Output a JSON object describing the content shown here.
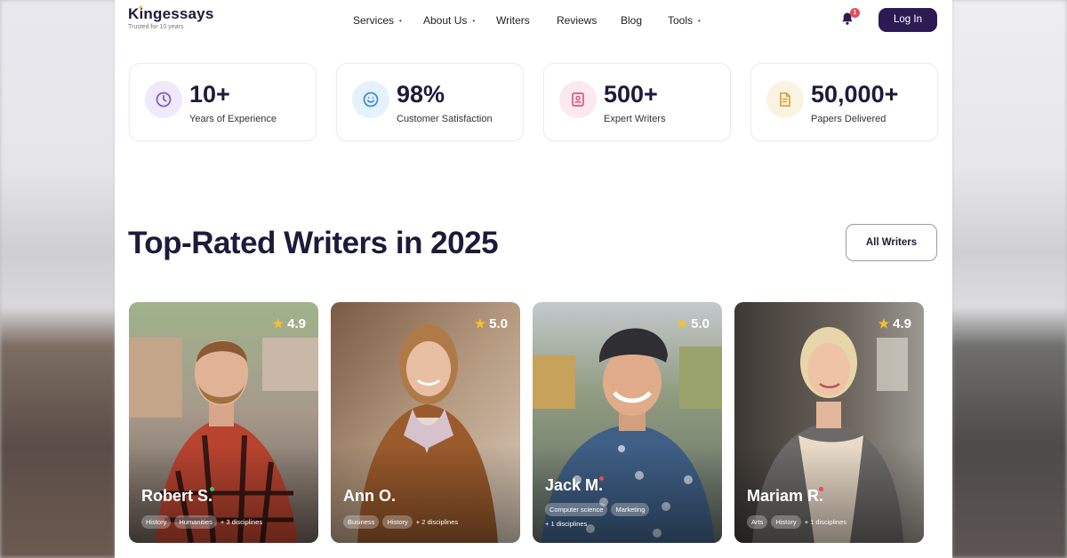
{
  "brand": {
    "name": "Kingessays",
    "tagline": "Trusted for 10 years"
  },
  "nav": [
    {
      "label": "Services",
      "dropdown": true
    },
    {
      "label": "About Us",
      "dropdown": true
    },
    {
      "label": "Writers",
      "dropdown": false
    },
    {
      "label": "Reviews",
      "dropdown": false
    },
    {
      "label": "Blog",
      "dropdown": false
    },
    {
      "label": "Tools",
      "dropdown": true
    }
  ],
  "notifications": {
    "count": "1"
  },
  "login_label": "Log In",
  "stats": [
    {
      "value": "10+",
      "label": "Years of Experience",
      "icon": "clock-icon",
      "color": "#7c5cc9",
      "bg": "#efe9fb"
    },
    {
      "value": "98%",
      "label": "Customer Satisfaction",
      "icon": "smile-icon",
      "color": "#3d8ed6",
      "bg": "#e5f1fb"
    },
    {
      "value": "500+",
      "label": "Expert Writers",
      "icon": "badge-icon",
      "color": "#d9577f",
      "bg": "#fbe9ef"
    },
    {
      "value": "50,000+",
      "label": "Papers Delivered",
      "icon": "document-icon",
      "color": "#d9a23a",
      "bg": "#fbf3e2"
    }
  ],
  "section": {
    "title": "Top-Rated Writers in 2025",
    "all_writers_label": "All Writers"
  },
  "writers": [
    {
      "name": "Robert S.",
      "rating": "4.9",
      "tags": [
        "History",
        "Humanities"
      ],
      "more": "+ 3 disciplines",
      "status_color": "#44c26b"
    },
    {
      "name": "Ann O.",
      "rating": "5.0",
      "tags": [
        "Business",
        "History"
      ],
      "more": "+ 2 disciplines",
      "status_color": ""
    },
    {
      "name": "Jack M.",
      "rating": "5.0",
      "tags": [
        "Computer science",
        "Marketing"
      ],
      "more": "+ 1 disciplines",
      "status_color": "#e64b5c"
    },
    {
      "name": "Mariam R.",
      "rating": "4.9",
      "tags": [
        "Arts",
        "History"
      ],
      "more": "+ 1 disciplines",
      "status_color": "#e64b5c"
    }
  ]
}
